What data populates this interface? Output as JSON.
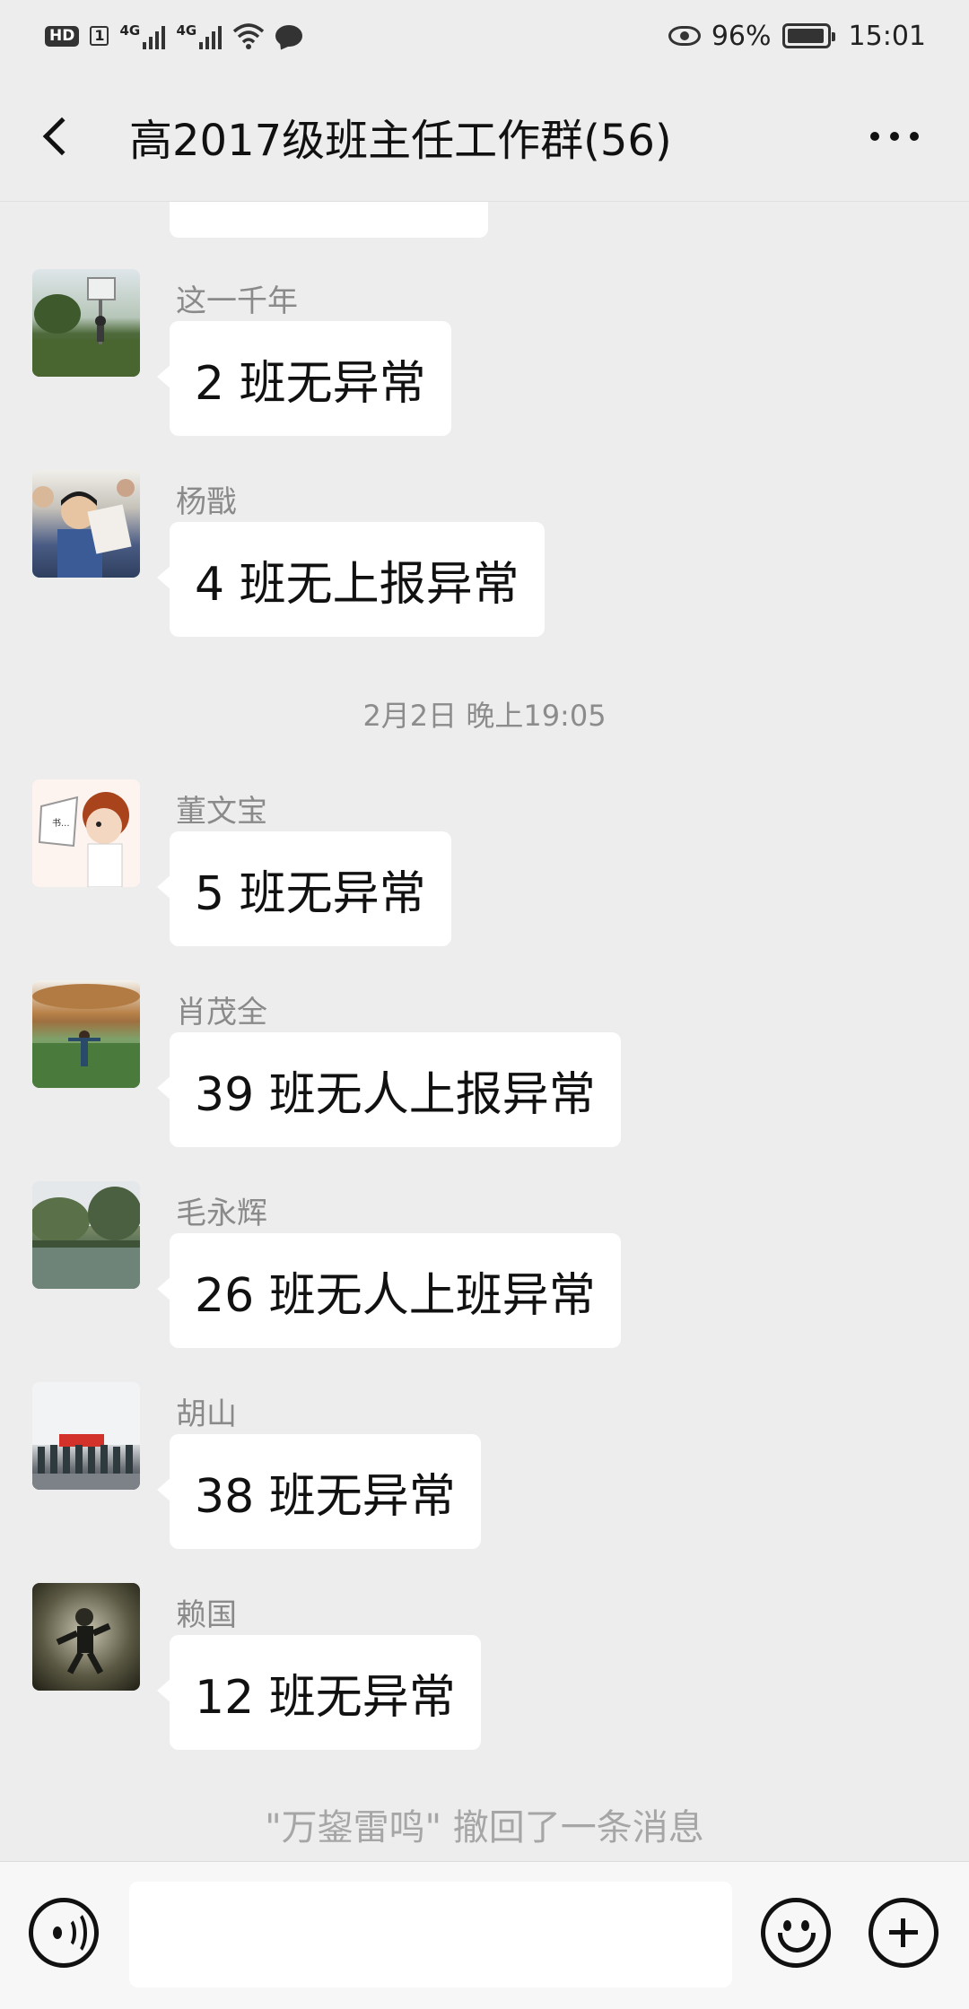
{
  "status_bar": {
    "hd_label": "HD",
    "sim_label": "1",
    "network_1": "4G",
    "network_2": "4G",
    "battery_percent": "96%",
    "battery_level": 0.96,
    "time": "15:01"
  },
  "nav": {
    "title": "高2017级班主任工作群(56)"
  },
  "messages_before": [
    {
      "sender": "这一千年",
      "text": "2 班无异常",
      "avatar": "photo-avatar"
    },
    {
      "sender": "杨戬",
      "text": "4 班无上报异常",
      "avatar": "photo-avatar"
    }
  ],
  "timestamp": "2月2日 晚上19:05",
  "messages_after": [
    {
      "sender": "董文宝",
      "text": "5 班无异常",
      "avatar": "cartoon-avatar"
    },
    {
      "sender": "肖茂全",
      "text": "39 班无人上报异常",
      "avatar": "photo-avatar"
    },
    {
      "sender": "毛永辉",
      "text": "26 班无人上班异常",
      "avatar": "photo-avatar"
    },
    {
      "sender": "胡山",
      "text": "38 班无异常",
      "avatar": "photo-avatar"
    },
    {
      "sender": "赖国",
      "text": "12 班无异常",
      "avatar": "photo-avatar"
    }
  ],
  "recall_notice": "\"万鋆雷鸣\" 撤回了一条消息",
  "input_bar": {
    "placeholder": "",
    "voice_icon": "voice-icon",
    "emoji_icon": "emoji-icon",
    "plus_icon": "plus-icon"
  }
}
